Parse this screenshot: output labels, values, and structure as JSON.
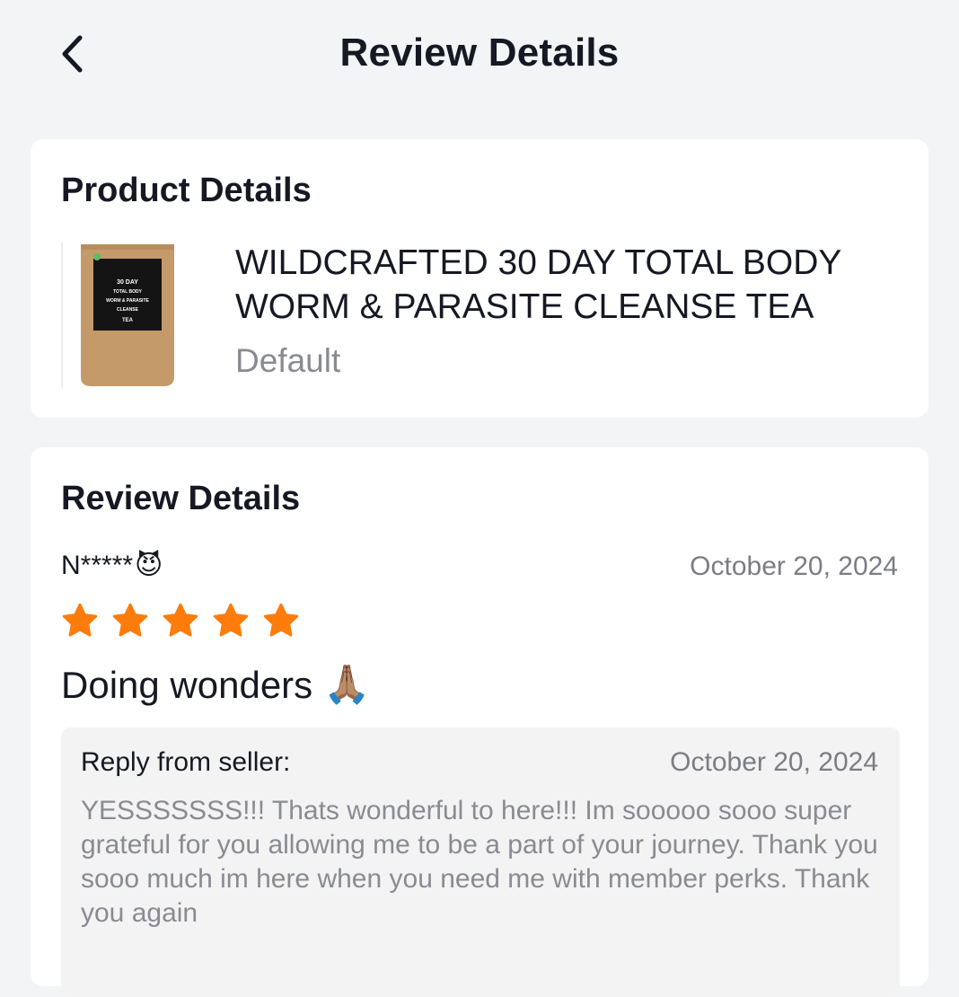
{
  "header": {
    "title": "Review Details",
    "back_icon": "chevron-left-icon"
  },
  "product": {
    "section_title": "Product Details",
    "name": "WILDCRAFTED 30 DAY TOTAL BODY WORM & PARASITE CLEANSE TEA",
    "variant": "Default",
    "image_label_lines": [
      "30 DAY",
      "TOTAL BODY",
      "WORM & PARASITE",
      "CLEANSE",
      "TEA"
    ]
  },
  "review": {
    "section_title": "Review Details",
    "reviewer": "N*****",
    "reviewer_emoji": "😈",
    "date": "October 20, 2024",
    "rating": 5,
    "text": "Doing wonders",
    "text_emoji": "🙏🏽",
    "star_color": "#fe7c0b"
  },
  "seller_reply": {
    "label": "Reply from seller:",
    "date": "October 20, 2024",
    "text": "YESSSSSSS!!! Thats wonderful to here!!! Im sooooo sooo super grateful for you allowing me to be a part of your journey.  Thank you sooo much im here when you need me with member perks. Thank you again"
  }
}
